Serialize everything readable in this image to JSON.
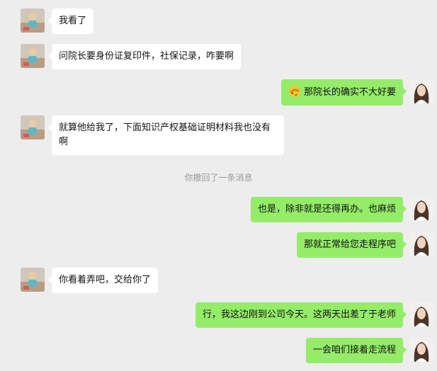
{
  "messages": [
    {
      "side": "left",
      "text": "我看了"
    },
    {
      "side": "left",
      "text": "问院长要身份证复印件，社保记录，咋要啊"
    },
    {
      "side": "right",
      "emoji": "facepalm-emoji",
      "text": "那院长的确实不大好要"
    },
    {
      "side": "left",
      "text": "就算他给我了，下面知识产权基础证明材料我也没有啊"
    },
    {
      "side": "system",
      "text": "你撤回了一条消息"
    },
    {
      "side": "right",
      "text": "也是，除非就是还得再办。也麻烦"
    },
    {
      "side": "right",
      "text": "那就正常给您走程序吧"
    },
    {
      "side": "left",
      "text": "你看着弄吧，交给你了"
    },
    {
      "side": "right",
      "text": "行，我这边刚到公司今天。这两天出差了于老师"
    },
    {
      "side": "right",
      "text": "一会咱们接着走流程"
    }
  ],
  "colors": {
    "background": "#ededed",
    "self_bubble": "#95ec69",
    "other_bubble": "#ffffff",
    "system_text": "#9a9a9a"
  },
  "icons": {
    "left_avatar": "baby-photo-avatar",
    "right_avatar": "woman-portrait-avatar"
  }
}
